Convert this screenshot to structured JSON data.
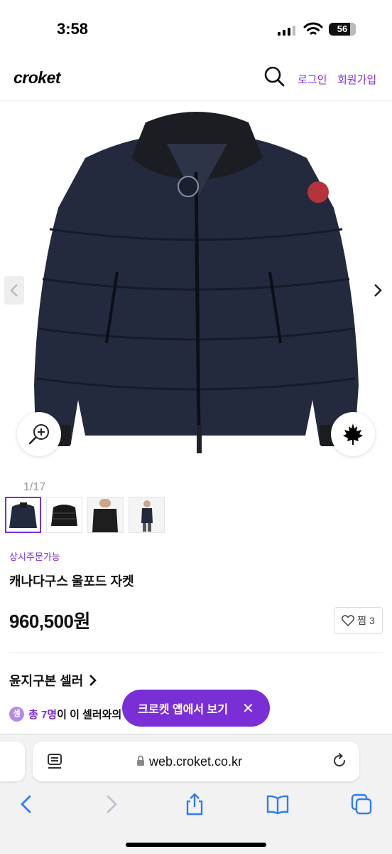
{
  "status": {
    "time": "3:58",
    "battery": "56"
  },
  "header": {
    "logo": "croket",
    "login": "로그인",
    "signup": "회원가입"
  },
  "gallery": {
    "counter": "1/17"
  },
  "product": {
    "availability": "상시주문가능",
    "title": "캐나다구스 울포드 자켓",
    "price": "960,500원",
    "wish_label": "찜",
    "wish_count": "3"
  },
  "seller": {
    "name": "윤지구본 셀러"
  },
  "notice": {
    "badge": "셈",
    "count": "총 7명",
    "text": "이 이 셀러와의"
  },
  "banner": {
    "label": "크로켓 앱에서 보기",
    "close": "✕"
  },
  "browser": {
    "url": "web.croket.co.kr"
  },
  "colors": {
    "accent": "#7a2fd6",
    "jacket": "#232a3e",
    "ios_blue": "#2f7cf6"
  }
}
